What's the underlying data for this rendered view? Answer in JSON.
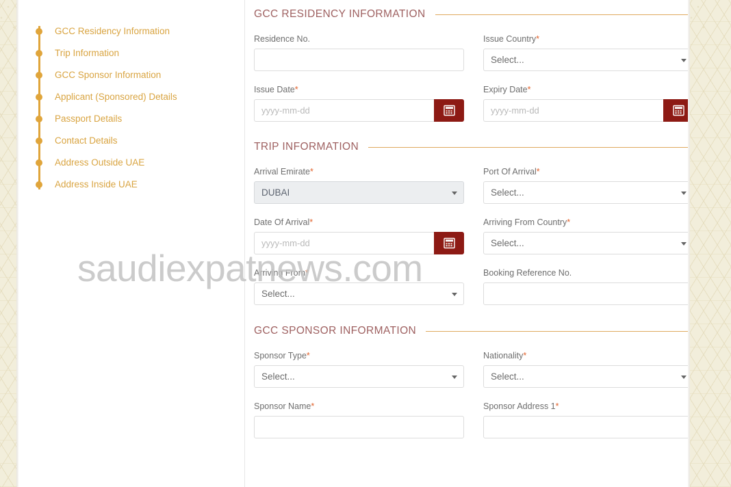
{
  "watermark": {
    "text": "saudiexpatnews.com"
  },
  "sidebar": {
    "items": [
      {
        "label": "GCC Residency Information",
        "name": "gcc-residency-information"
      },
      {
        "label": "Trip Information",
        "name": "trip-information"
      },
      {
        "label": "GCC Sponsor Information",
        "name": "gcc-sponsor-information"
      },
      {
        "label": "Applicant (Sponsored) Details",
        "name": "applicant-sponsored-details"
      },
      {
        "label": "Passport Details",
        "name": "passport-details"
      },
      {
        "label": "Contact Details",
        "name": "contact-details"
      },
      {
        "label": "Address Outside UAE",
        "name": "address-outside-uae"
      },
      {
        "label": "Address Inside UAE",
        "name": "address-inside-uae"
      }
    ]
  },
  "sections": {
    "residency": {
      "title": "GCC RESIDENCY INFORMATION",
      "residence_no": {
        "label": "Residence No.",
        "required": false,
        "value": "",
        "placeholder": ""
      },
      "issue_country": {
        "label": "Issue Country",
        "required": true,
        "value": "Select..."
      },
      "issue_date": {
        "label": "Issue Date",
        "required": true,
        "value": "",
        "placeholder": "yyyy-mm-dd"
      },
      "expiry_date": {
        "label": "Expiry Date",
        "required": true,
        "value": "",
        "placeholder": "yyyy-mm-dd"
      }
    },
    "trip": {
      "title": "TRIP INFORMATION",
      "arrival_emirate": {
        "label": "Arrival Emirate",
        "required": true,
        "value": "DUBAI"
      },
      "port_of_arrival": {
        "label": "Port Of Arrival",
        "required": true,
        "value": "Select..."
      },
      "date_of_arrival": {
        "label": "Date Of Arrival",
        "required": true,
        "value": "",
        "placeholder": "yyyy-mm-dd"
      },
      "arriving_from_country": {
        "label": "Arriving From Country",
        "required": true,
        "value": "Select..."
      },
      "arriving_from": {
        "label": "Arriving From",
        "required": true,
        "value": "Select..."
      },
      "booking_reference_no": {
        "label": "Booking Reference No.",
        "required": false,
        "value": "",
        "placeholder": ""
      }
    },
    "sponsor": {
      "title": "GCC SPONSOR INFORMATION",
      "sponsor_type": {
        "label": "Sponsor Type",
        "required": true,
        "value": "Select..."
      },
      "nationality": {
        "label": "Nationality",
        "required": true,
        "value": "Select..."
      },
      "sponsor_name": {
        "label": "Sponsor Name",
        "required": true,
        "value": "",
        "placeholder": ""
      },
      "sponsor_address_1": {
        "label": "Sponsor Address 1",
        "required": true,
        "value": "",
        "placeholder": ""
      }
    }
  },
  "icons": {
    "calendar": "calendar-icon",
    "dropdown": "chevron-down-icon",
    "required_marker": "*"
  },
  "colors": {
    "accent_gold": "#e0a53b",
    "section_title": "#9e6060",
    "section_rule": "#dfa95e",
    "date_button": "#8d1a14",
    "required_asterisk": "#e2622c",
    "pattern_bg": "#f2eedb"
  }
}
